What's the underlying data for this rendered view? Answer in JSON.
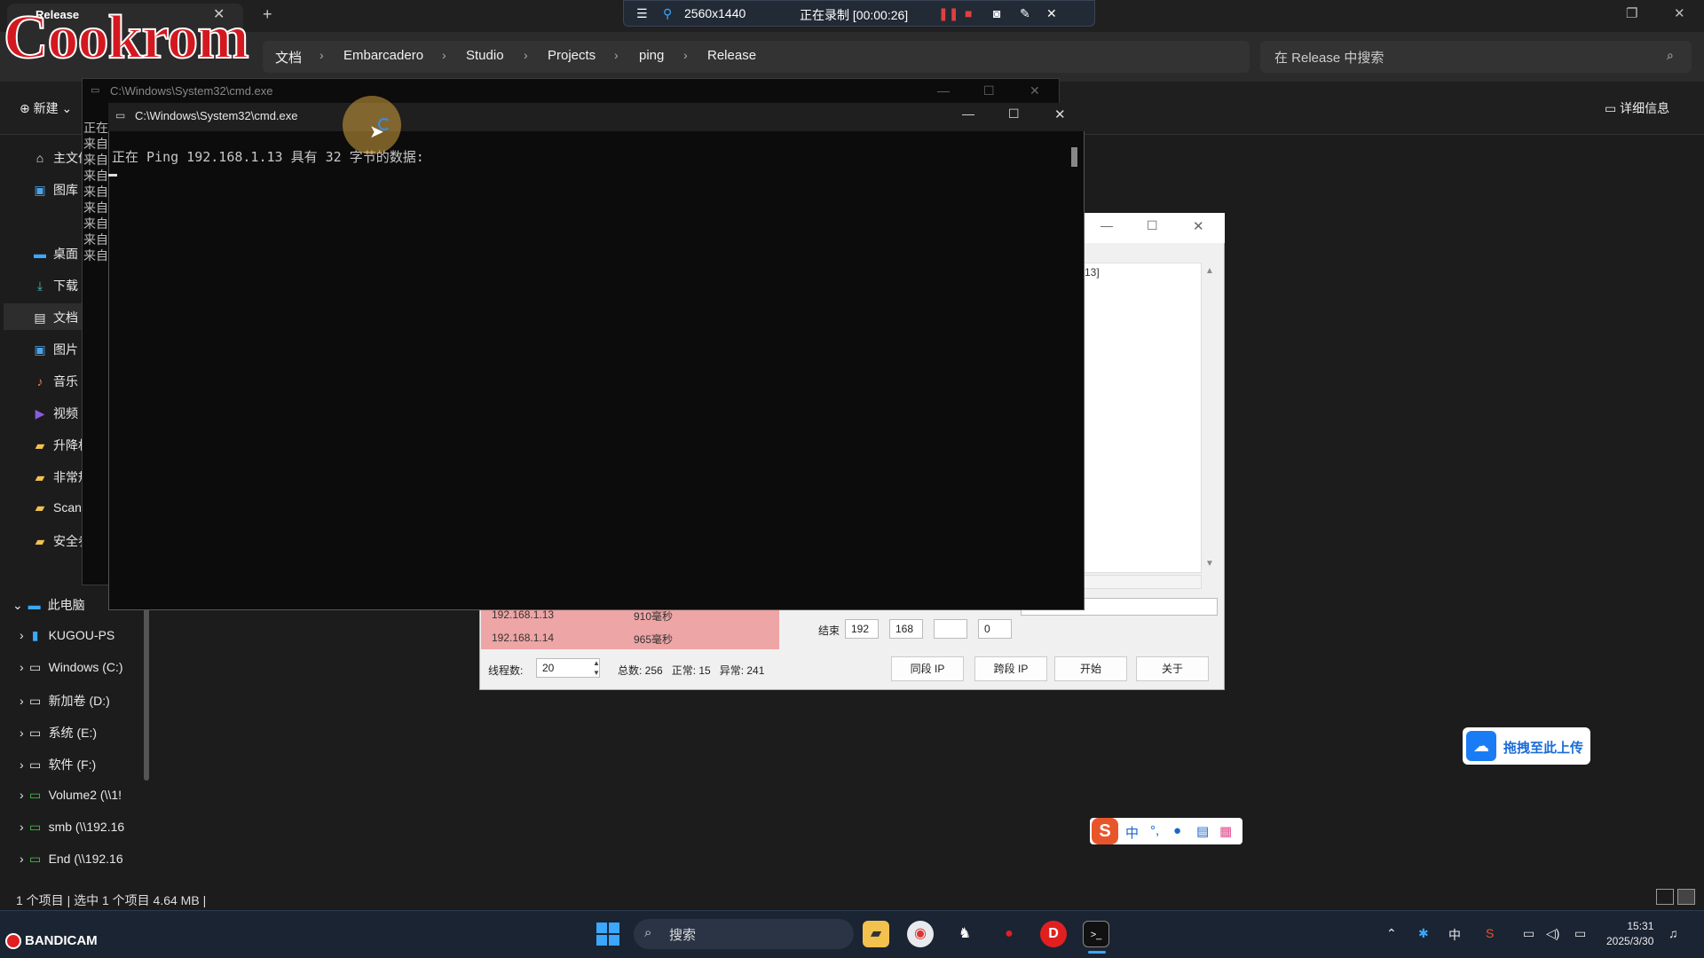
{
  "explorer": {
    "tab_title": "Release",
    "breadcrumbs": [
      "文档",
      "Embarcadero",
      "Studio",
      "Projects",
      "ping",
      "Release"
    ],
    "search_placeholder": "在 Release 中搜索",
    "new_label": "新建",
    "details_label": "详细信息",
    "sidebar": {
      "quick": [
        "主文件夹",
        "图库"
      ],
      "pinned": [
        "桌面",
        "下载",
        "文档",
        "图片",
        "音乐",
        "视频",
        "升降机",
        "非常规",
        "Scan",
        "安全参"
      ],
      "this_pc": "此电脑",
      "drives": [
        "KUGOU-PS",
        "Windows (C:)",
        "新加卷 (D:)",
        "系统 (E:)",
        "软件 (F:)",
        "Volume2 (\\\\1!",
        "smb (\\\\192.16",
        "End (\\\\192.16"
      ]
    },
    "status": "1 个项目 | 选中 1 个项目 4.64 MB |"
  },
  "recorder": {
    "resolution": "2560x1440",
    "status": "正在录制 [00:00:26]"
  },
  "logo_text": "Cookrom",
  "cmd_back": {
    "title": "C:\\Windows\\System32\\cmd.exe",
    "lines": [
      "正在",
      "来自",
      "来自",
      "来自",
      "来自",
      "来自",
      "来自",
      "来自",
      "来自"
    ]
  },
  "cmd_front": {
    "title": "C:\\Windows\\System32\\cmd.exe",
    "line": "正在 Ping 192.168.1.13 具有 32 字节的数据:"
  },
  "ping_tool": {
    "list_fragment": "13]",
    "rows": [
      {
        "ip": "192.168.1.13",
        "time": "910毫秒"
      },
      {
        "ip": "192.168.1.14",
        "time": "965毫秒"
      }
    ],
    "end_label": "结束",
    "end_ip": [
      "192",
      "168",
      "",
      "0"
    ],
    "threads_label": "线程数:",
    "threads_value": "20",
    "summary": "总数: 256   正常: 15   异常: 241",
    "buttons": [
      "同段 IP",
      "跨段 IP",
      "开始",
      "关于"
    ]
  },
  "upload_widget": "拖拽至此上传",
  "ime": {
    "logo": "S",
    "lang": "中"
  },
  "taskbar": {
    "search_label": "搜索",
    "tray_lang": "中",
    "time": "15:31",
    "date": "2025/3/30"
  },
  "bandicam": "BANDICAM",
  "colors": {
    "accent": "#3ba7ff",
    "record_red": "#e02020",
    "ping_error": "#eea5a5"
  }
}
